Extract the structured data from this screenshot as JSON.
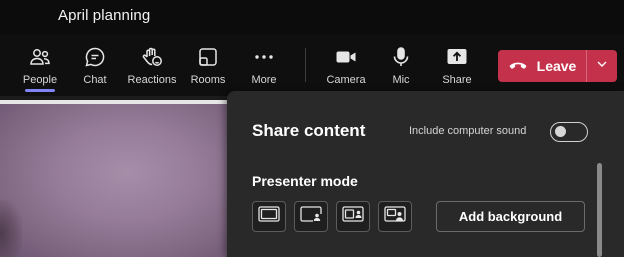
{
  "window": {
    "title": "April planning"
  },
  "toolbar": {
    "people": "People",
    "chat": "Chat",
    "reactions": "Reactions",
    "rooms": "Rooms",
    "more": "More",
    "camera": "Camera",
    "mic": "Mic",
    "share": "Share",
    "leave": "Leave",
    "active_item": "People"
  },
  "share_panel": {
    "title": "Share content",
    "computer_sound_label": "Include computer sound",
    "computer_sound_on": false,
    "presenter_mode_title": "Presenter mode",
    "presenter_modes": [
      "content-only-icon",
      "standout-icon",
      "side-by-side-icon",
      "reporter-icon"
    ],
    "add_background_label": "Add background"
  },
  "colors": {
    "leave": "#c4314b",
    "accent": "#7f85f5",
    "panel": "#292929"
  }
}
